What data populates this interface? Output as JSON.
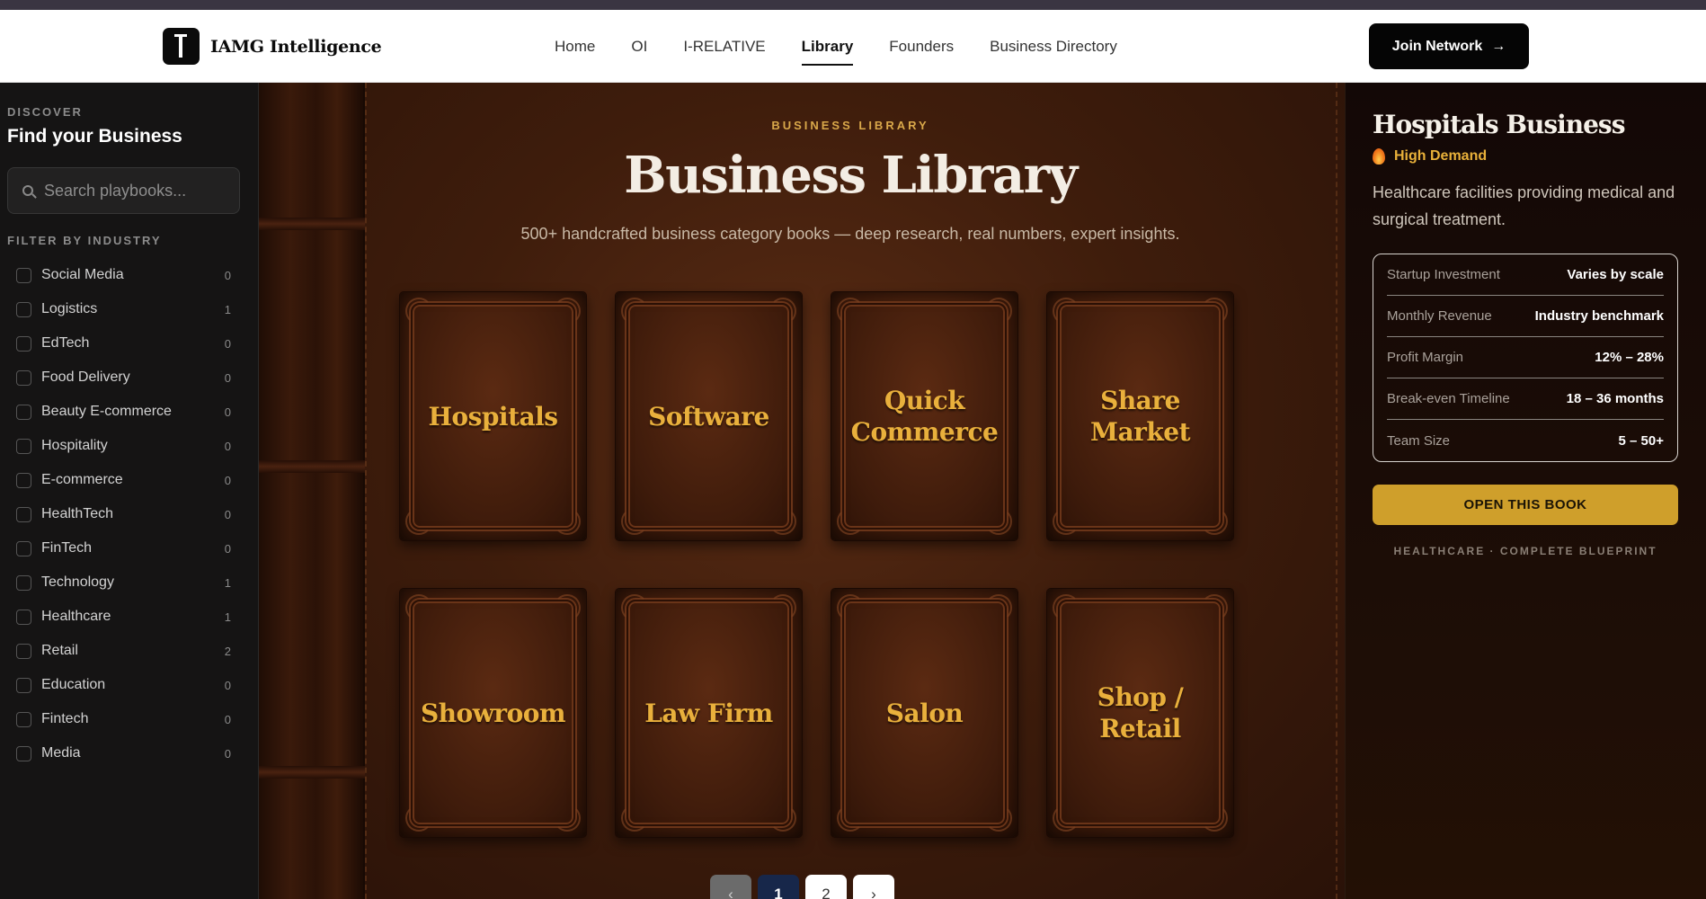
{
  "header": {
    "brand": "IAMG Intelligence",
    "nav": [
      {
        "label": "Home",
        "active": false
      },
      {
        "label": "OI",
        "active": false
      },
      {
        "label": "I-RELATIVE",
        "active": false
      },
      {
        "label": "Library",
        "active": true
      },
      {
        "label": "Founders",
        "active": false
      },
      {
        "label": "Business Directory",
        "active": false
      }
    ],
    "cta": {
      "label": "Join Network",
      "arrow": "→"
    }
  },
  "sidebar": {
    "eyebrow": "DISCOVER",
    "title": "Find your Business",
    "search": {
      "placeholder": "Search playbooks...",
      "value": ""
    },
    "filter_label": "FILTER BY INDUSTRY",
    "filters": [
      {
        "name": "Social Media",
        "count": "0"
      },
      {
        "name": "Logistics",
        "count": "1"
      },
      {
        "name": "EdTech",
        "count": "0"
      },
      {
        "name": "Food Delivery",
        "count": "0"
      },
      {
        "name": "Beauty E-commerce",
        "count": "0"
      },
      {
        "name": "Hospitality",
        "count": "0"
      },
      {
        "name": "E-commerce",
        "count": "0"
      },
      {
        "name": "HealthTech",
        "count": "0"
      },
      {
        "name": "FinTech",
        "count": "0"
      },
      {
        "name": "Technology",
        "count": "1"
      },
      {
        "name": "Healthcare",
        "count": "1"
      },
      {
        "name": "Retail",
        "count": "2"
      },
      {
        "name": "Education",
        "count": "0"
      },
      {
        "name": "Fintech",
        "count": "0"
      },
      {
        "name": "Media",
        "count": "0"
      }
    ]
  },
  "library": {
    "eyebrow": "BUSINESS LIBRARY",
    "title": "Business Library",
    "subtitle": "500+ handcrafted business category books — deep research, real numbers, expert insights.",
    "books": [
      "Hospitals",
      "Software",
      "Quick Commerce",
      "Share Market",
      "Showroom",
      "Law Firm",
      "Salon",
      "Shop / Retail"
    ],
    "pagination": {
      "prev": "‹",
      "pages": [
        "1",
        "2"
      ],
      "current": "1",
      "next": "›"
    }
  },
  "detail": {
    "title": "Hospitals Business",
    "demand": "High Demand",
    "description": "Healthcare facilities providing medical and surgical treatment.",
    "stats": [
      {
        "label": "Startup Investment",
        "value": "Varies by scale"
      },
      {
        "label": "Monthly Revenue",
        "value": "Industry benchmark"
      },
      {
        "label": "Profit Margin",
        "value": "12% – 28%"
      },
      {
        "label": "Break-even Timeline",
        "value": "18 – 36 months"
      },
      {
        "label": "Team Size",
        "value": "5 – 50+"
      }
    ],
    "open_button": "OPEN THIS BOOK",
    "footer": "HEALTHCARE · COMPLETE BLUEPRINT"
  },
  "colors": {
    "accent_gold": "#cf9f2b",
    "book_title": "#e9b03c",
    "pager_active": "#17274a"
  }
}
